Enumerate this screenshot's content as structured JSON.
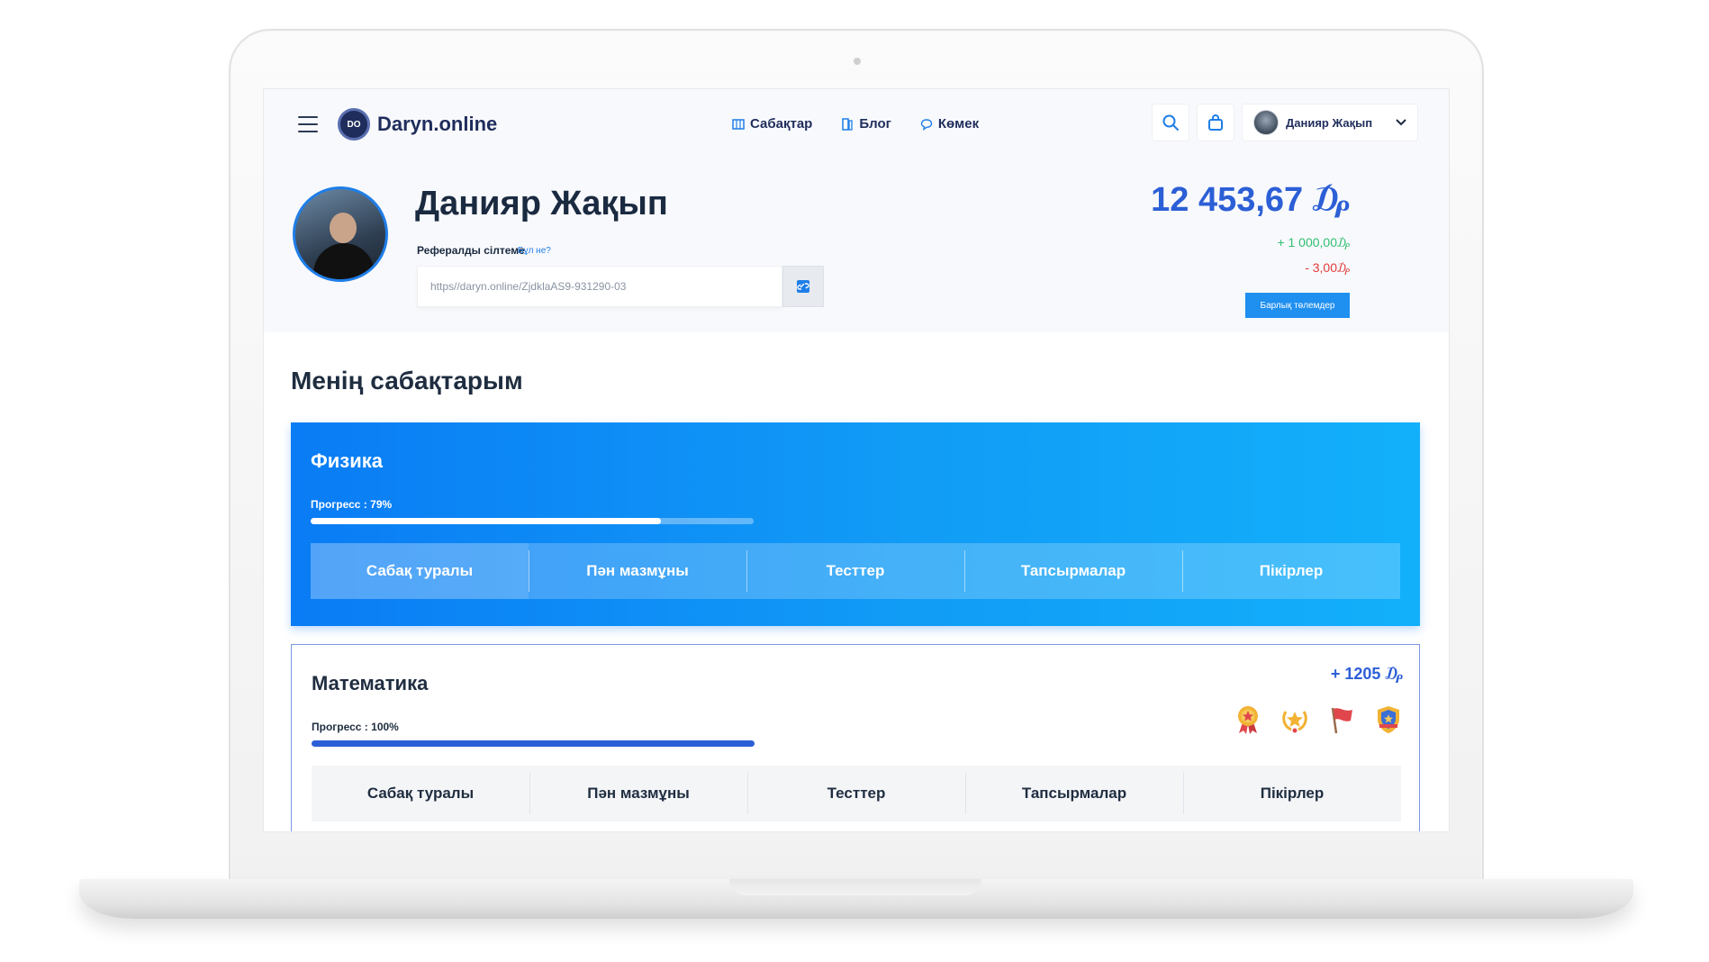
{
  "nav": {
    "brand": "Daryn.online",
    "brand_initials": "DO",
    "links": [
      {
        "label": "Сабақтар",
        "icon": "book-icon"
      },
      {
        "label": "Блог",
        "icon": "blog-icon"
      },
      {
        "label": "Көмек",
        "icon": "chat-icon"
      }
    ],
    "user_name": "Данияр Жақып"
  },
  "profile": {
    "name": "Данияр Жақып",
    "referral_label": "Рефералды сілтеме",
    "referral_help": "Бұл не?",
    "referral_link": "https//daryn.online/ZjdklaAS9-931290-03",
    "balance": "12 453,67 ₯",
    "plus_amount": "+ 1 000,00₯",
    "minus_amount": "- 3,00₯",
    "payments_button": "Барлық төлемдер"
  },
  "lessons": {
    "title": "Менің сабақтарым",
    "courses": [
      {
        "name": "Физика",
        "progress_label": "Прогресс : 79%",
        "progress": 0.79,
        "tabs": [
          "Сабақ туралы",
          "Пән мазмұны",
          "Тесттер",
          "Тапсырмалар",
          "Пікірлер"
        ]
      },
      {
        "name": "Математика",
        "progress_label": "Прогресс : 100%",
        "progress": 1.0,
        "bonus": "+ 1205 ₯",
        "badges": [
          "medal-icon",
          "laurel-star-icon",
          "flag-icon",
          "shield-badge-icon"
        ],
        "tabs": [
          "Сабақ туралы",
          "Пән мазмұны",
          "Тесттер",
          "Тапсырмалар",
          "Пікірлер"
        ]
      }
    ]
  },
  "colors": {
    "accent": "#2c5fd6",
    "primary_blue": "#1f8ff0",
    "positive": "#2fbf71",
    "negative": "#e23b3b"
  }
}
